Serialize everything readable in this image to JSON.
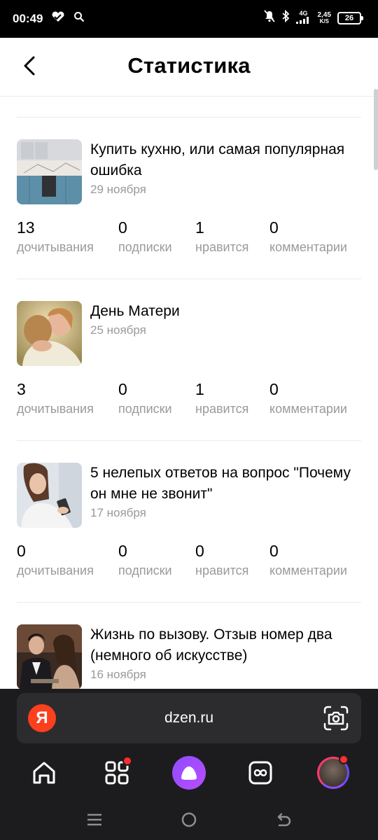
{
  "status_bar": {
    "time": "00:49",
    "network": "4G",
    "speed_value": "2,45",
    "speed_unit": "K/S",
    "battery": "26"
  },
  "header": {
    "title": "Статистика"
  },
  "stat_labels": {
    "reads": "дочитывания",
    "subs": "подписки",
    "likes": "нравится",
    "comments": "комментарии"
  },
  "articles": [
    {
      "title": "Купить кухню, или самая популярная ошибка",
      "date": "29 ноября",
      "reads": "13",
      "subs": "0",
      "likes": "1",
      "comments": "0"
    },
    {
      "title": "День Матери",
      "date": "25 ноября",
      "reads": "3",
      "subs": "0",
      "likes": "1",
      "comments": "0"
    },
    {
      "title": "5 нелепых ответов на вопрос \"Почему он мне не звонит\"",
      "date": "17 ноября",
      "reads": "0",
      "subs": "0",
      "likes": "0",
      "comments": "0"
    },
    {
      "title": "Жизнь по вызову. Отзыв номер два (немного об искусстве)",
      "date": "16 ноября"
    }
  ],
  "browser": {
    "logo": "Я",
    "url": "dzen.ru"
  },
  "colors": {
    "accent": "#8f4cff",
    "notification": "#ff2d2d",
    "yandex": "#fc3f1d"
  },
  "icons": [
    "home-icon",
    "apps-icon",
    "alice-icon",
    "tabs-icon",
    "profile-avatar",
    "camera-icon",
    "back-arrow-icon"
  ]
}
